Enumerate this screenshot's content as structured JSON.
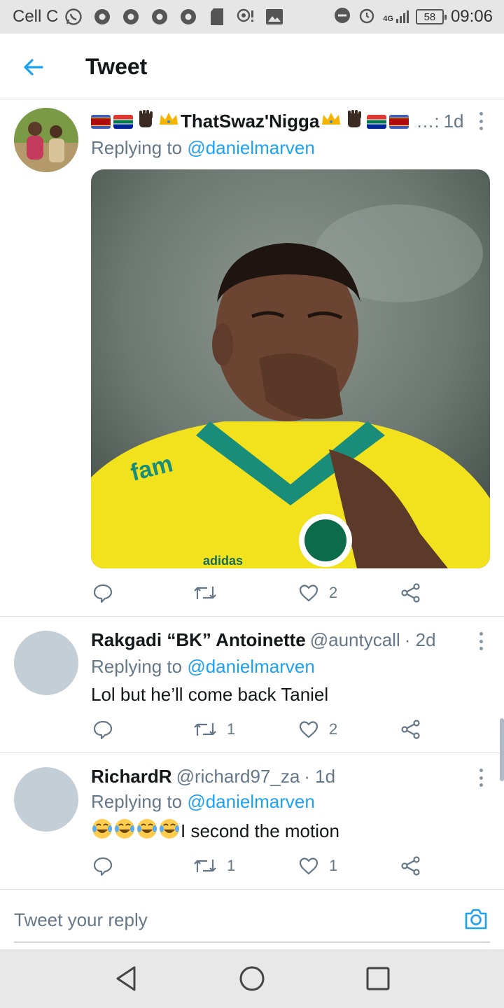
{
  "status_bar": {
    "carrier": "Cell C",
    "network": "4G",
    "battery": "58",
    "time": "09:06"
  },
  "header": {
    "title": "Tweet"
  },
  "tweets": [
    {
      "display_name": "ThatSwaz'Nigga",
      "handle": "",
      "time": "1d",
      "replying_label": "Replying to ",
      "replying_to": "@danielmarven",
      "text": "",
      "has_image": true,
      "reply_count": "",
      "retweet_count": "",
      "like_count": "2"
    },
    {
      "display_name": "Rakgadi “BK” Antoinette",
      "handle": "@auntycall",
      "time": "· 2d",
      "replying_label": "Replying to ",
      "replying_to": "@danielmarven",
      "text": "Lol but he’ll come back Taniel",
      "reply_count": "",
      "retweet_count": "1",
      "like_count": "2"
    },
    {
      "display_name": "RichardR",
      "handle": "@richard97_za",
      "time": "· 1d",
      "replying_label": "Replying to ",
      "replying_to": "@danielmarven",
      "text": "I second the motion",
      "reply_count": "",
      "retweet_count": "1",
      "like_count": "1"
    }
  ],
  "reply_bar": {
    "placeholder": "Tweet your reply"
  },
  "colors": {
    "accent": "#1da1f2",
    "secondary_text": "#657786",
    "primary_text": "#14171a",
    "divider": "#d9dde1"
  },
  "icons": {
    "back": "arrow-left-icon",
    "reply": "comment-icon",
    "retweet": "retweet-icon",
    "like": "heart-icon",
    "share": "share-icon",
    "camera": "camera-icon"
  }
}
